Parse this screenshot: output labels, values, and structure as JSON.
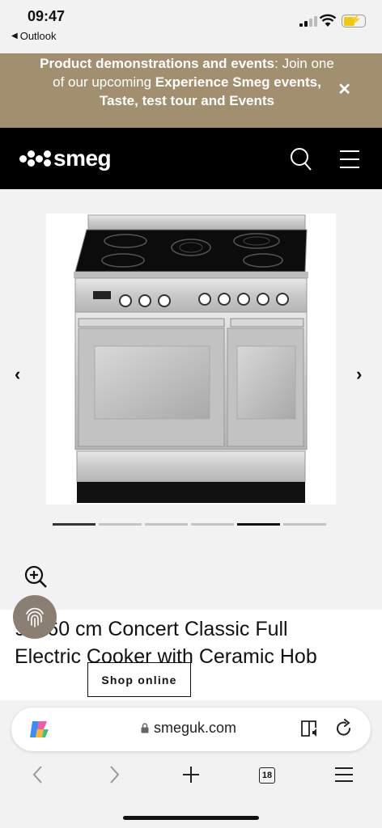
{
  "status": {
    "time": "09:47",
    "back_app": "Outlook"
  },
  "promo": {
    "bold_part1": "Product demonstrations and events",
    "normal_part": ": Join one of our upcoming ",
    "bold_part2": "Experience Smeg events, Taste, test tour and Events"
  },
  "header": {
    "logo": "smeg"
  },
  "carousel": {
    "slide_count": 6,
    "active_index": 4
  },
  "product": {
    "title_line1": "90x60 cm Concert Classic Full",
    "title_line2": "Electric Cooker with Ceramic Hob"
  },
  "shop_button": {
    "label": "Shop online"
  },
  "browser": {
    "url": "smeguk.com",
    "tab_count": "18"
  },
  "colors": {
    "promo_bg": "#a28f6f",
    "header_bg": "#000000",
    "fingerprint_bg": "#8b7f74"
  }
}
